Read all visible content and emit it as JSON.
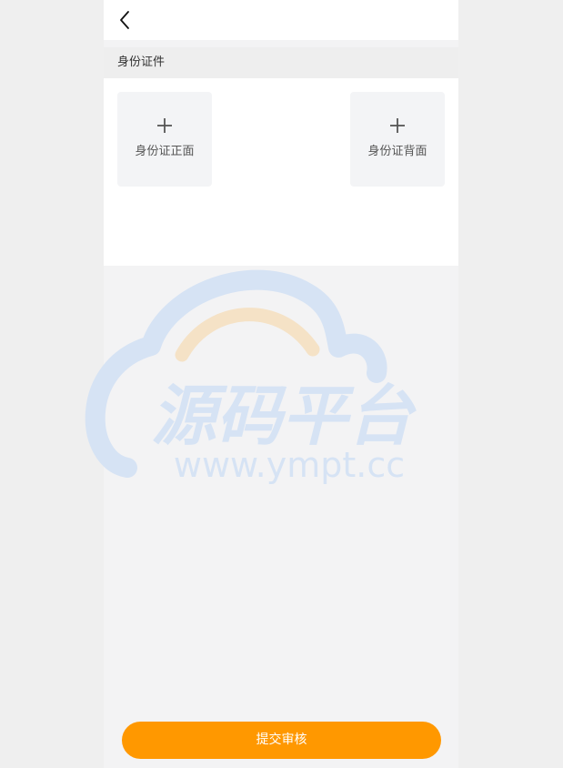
{
  "header": {
    "back_icon": "chevron-left-icon"
  },
  "section": {
    "title": "身份证件"
  },
  "uploads": {
    "front_label": "身份证正面",
    "back_label": "身份证背面",
    "icon": "plus-icon"
  },
  "watermark": {
    "brand_text": "源码平台",
    "url_text": "www.ympt.cc"
  },
  "footer": {
    "submit_label": "提交审核"
  },
  "colors": {
    "page_background": "#efefef",
    "content_background": "#f3f3f4",
    "accent": "#ff9800",
    "upload_box": "#f3f4f6",
    "watermark_blue": "#d6e3f4",
    "watermark_orange": "#f5e2c6"
  }
}
